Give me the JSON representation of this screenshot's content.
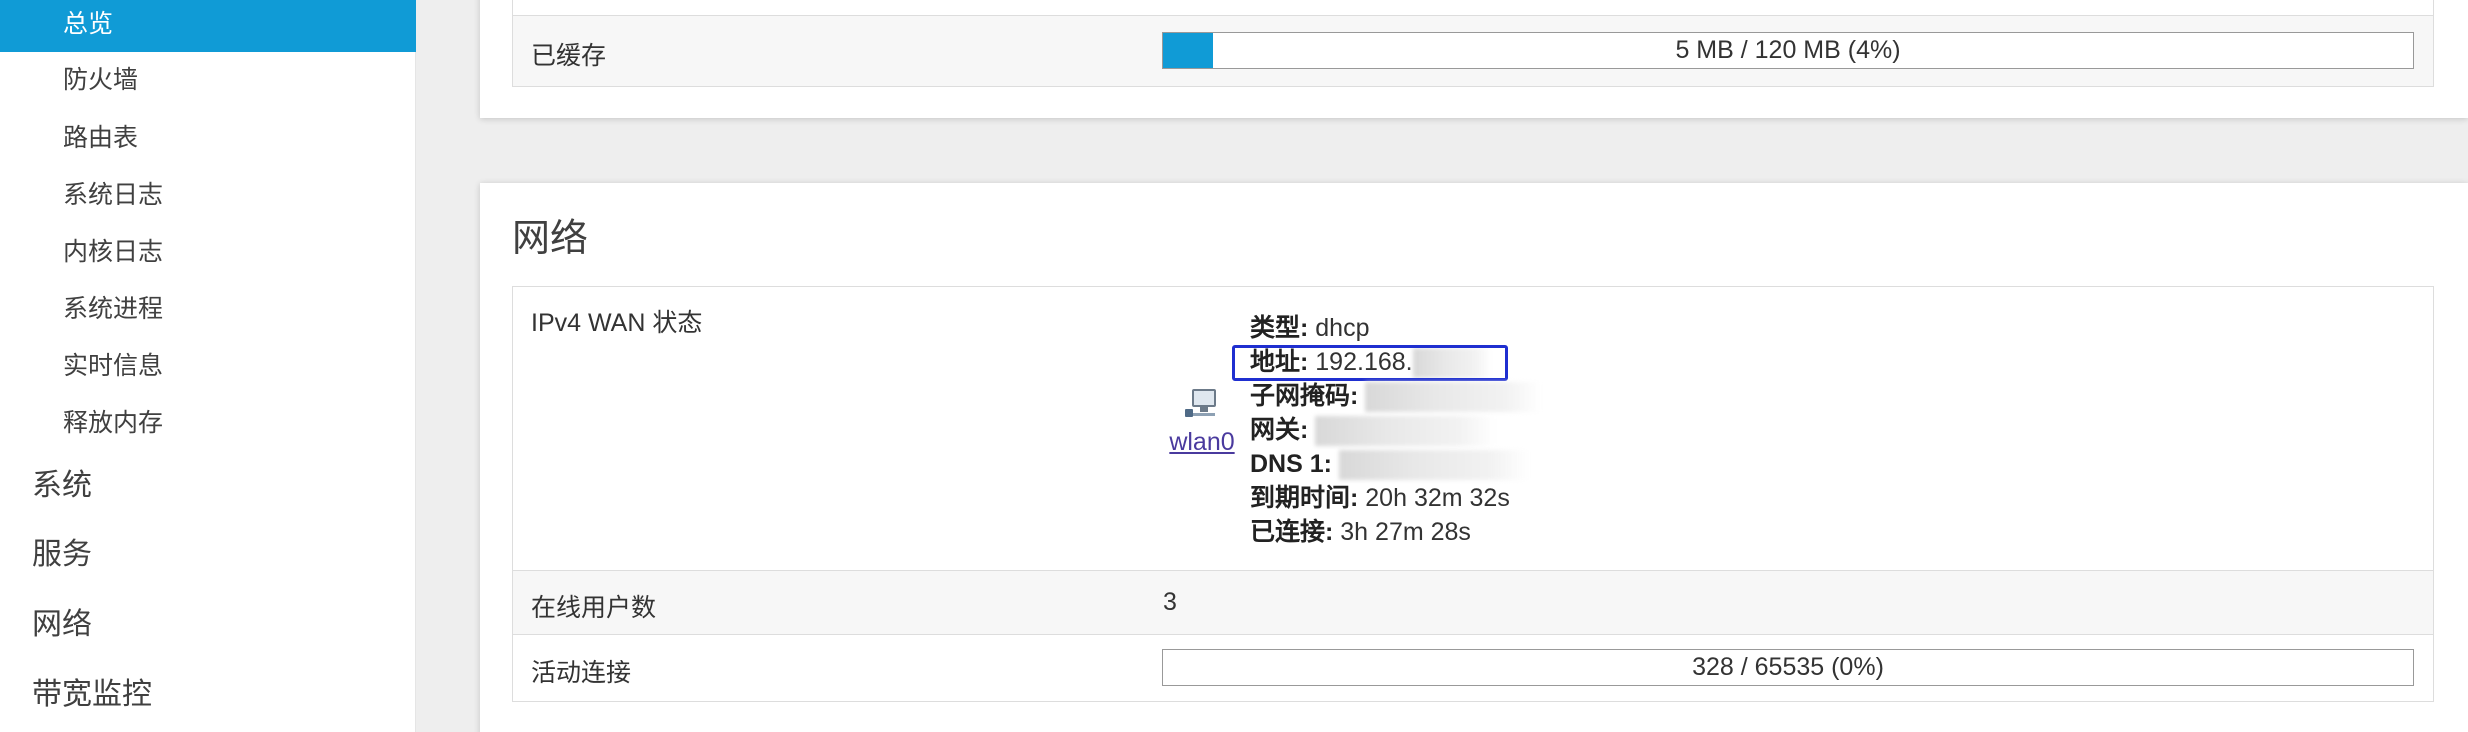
{
  "sidebar": {
    "items": [
      {
        "label": "总览",
        "active": true
      },
      {
        "label": "防火墙"
      },
      {
        "label": "路由表"
      },
      {
        "label": "系统日志"
      },
      {
        "label": "内核日志"
      },
      {
        "label": "系统进程"
      },
      {
        "label": "实时信息"
      },
      {
        "label": "释放内存"
      }
    ],
    "groups": [
      "系统",
      "服务",
      "网络",
      "带宽监控"
    ]
  },
  "memory": {
    "cached_label": "已缓存",
    "cached_value": "5 MB / 120 MB (4%)",
    "cached_percent": 4
  },
  "network": {
    "title": "网络",
    "wan_label": "IPv4 WAN 状态",
    "iface": "wlan0",
    "type_label": "类型:",
    "type_value": "dhcp",
    "address_label": "地址:",
    "address_value": "192.168.",
    "netmask_label": "子网掩码:",
    "gateway_label": "网关:",
    "dns_label": "DNS 1:",
    "expires_label": "到期时间:",
    "expires_value": "20h 32m 32s",
    "connected_label": "已连接:",
    "connected_value": "3h 27m 28s",
    "online_users_label": "在线用户数",
    "online_users_value": "3",
    "active_conn_label": "活动连接",
    "active_conn_value": "328 / 65535 (0%)",
    "active_conn_percent": 0
  },
  "colors": {
    "accent": "#109bd6",
    "highlight_box": "#1f2fd0"
  }
}
